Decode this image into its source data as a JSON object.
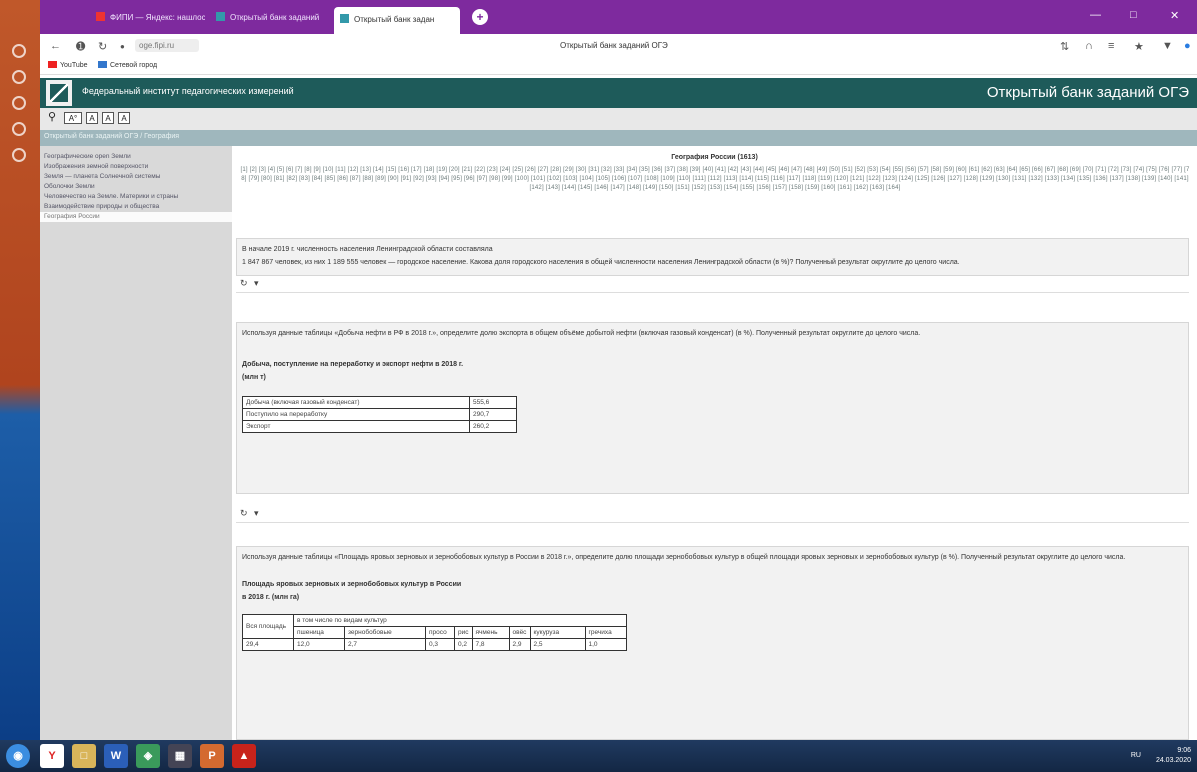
{
  "browser": {
    "tabs": [
      {
        "label": "ФИПИ — Яндекс: нашлось"
      },
      {
        "label": "Открытый банк заданий"
      },
      {
        "label": "Открытый банк задан"
      }
    ],
    "new_tab": "+",
    "url": "oge.fipi.ru",
    "page_title": "Открытый банк заданий ОГЭ",
    "bookmarks": [
      "YouTube",
      "Сетевой город"
    ]
  },
  "site": {
    "org_name": "Федеральный институт педагогических измерений",
    "bank_name": "Открытый банк заданий ОГЭ",
    "toolbar": [
      "A°",
      "A",
      "A",
      "A"
    ],
    "breadcrumb": "Открытый банк заданий ОГЭ / География"
  },
  "leftnav": {
    "items": [
      "Географические open Земли",
      "Изображения земной поверхности",
      "Земля — планета Солнечной системы",
      "Оболочки Земли",
      "Человечество на Земле. Материки и страны",
      "Взаимодействие природы и общества",
      "География России"
    ]
  },
  "content": {
    "topic_title": "География России (1613)",
    "pager": "[1] [2] [3] [4] [5] [6] [7] [8] [9] [10] [11] [12] [13] [14] [15] [16] [17] [18] [19] [20] [21] [22] [23] [24] [25] [26] [27] [28] [29] [30] [31] [32] [33] [34] [35] [36] [37] [38] [39] [40] [41] [42] [43] [44] [45] [46] [47] [48] [49] [50] [51] [52] [53] [54] [55] [56] [57] [58] [59] [60] [61] [62] [63] [64] [65] [66] [67] [68] [69] [70] [71] [72] [73] [74] [75] [76] [77] [78] [79] [80] [81] [82] [83] [84] [85] [86] [87] [88] [89] [90] [91] [92] [93] [94] [95] [96] [97] [98] [99] [100] [101] [102] [103] [104] [105] [106] [107] [108] [109] [110] [111] [112] [113] [114] [115] [116] [117] [118] [119] [120] [121] [122] [123] [124] [125] [126] [127] [128] [129] [130] [131] [132] [133] [134] [135] [136] [137] [138] [139] [140] [141] [142] [143] [144] [145] [146] [147] [148] [149] [150] [151] [152] [153] [154] [155] [156] [157] [158] [159] [160] [161] [162] [163] [164]",
    "q1": {
      "line1": "В начале 2019 г. численность населения Ленинградской области составляла",
      "line2": "1 847 867 человек, из них 1 189 555 человек — городское население. Какова доля городского населения в общей численности населения Ленинградской области (в %)? Полученный результат округлите до целого числа."
    },
    "q2": {
      "text": "Используя данные таблицы «Добыча нефти в РФ в 2018 г.», определите долю экспорта в общем объёме добытой нефти (включая газовый конденсат) (в %). Полученный результат округлите до целого числа.",
      "table_title": "Добыча, поступление на переработку и экспорт нефти в 2018 г.",
      "table_unit": "(млн т)",
      "rows": [
        {
          "label": "Добыча (включая газовый конденсат)",
          "value": "555,6"
        },
        {
          "label": "Поступило на переработку",
          "value": "290,7"
        },
        {
          "label": "Экспорт",
          "value": "260,2"
        }
      ]
    },
    "q3": {
      "text": "Используя данные таблицы «Площадь яровых зерновых и зернобобовых культур в России в 2018 г.», определите долю площади зернобобовых культур в общей площади яровых зерновых и зернобобовых культур (в %). Полученный результат округлите до целого числа.",
      "table_title": "Площадь яровых зерновых и зернобобовых культур в России",
      "table_subtitle": "в 2018 г. (млн га)",
      "col_all": "Вся площадь",
      "col_group": "в том числе по видам культур",
      "crops": [
        "пшеница",
        "зернобобовые",
        "просо",
        "рис",
        "ячмень",
        "овёс",
        "кукуруза",
        "гречиха"
      ],
      "values": [
        "29,4",
        "12,0",
        "2,7",
        "0,3",
        "0,2",
        "7,8",
        "2,9",
        "2,5",
        "1,0"
      ]
    }
  },
  "taskbar": {
    "lang": "RU",
    "time": "9:06",
    "date": "24.03.2020"
  }
}
